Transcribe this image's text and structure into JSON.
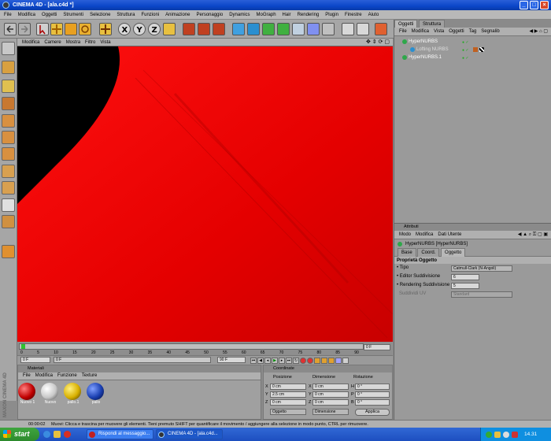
{
  "window": {
    "title": "CINEMA 4D - [ala.c4d *]",
    "buttons": {
      "minimize": "_",
      "maximize": "□",
      "close": "×"
    }
  },
  "menubar": [
    "File",
    "Modifica",
    "Oggetti",
    "Strumenti",
    "Selezione",
    "Struttura",
    "Funzioni",
    "Animazione",
    "Personaggio",
    "Dynamics",
    "MoGraph",
    "Hair",
    "Rendering",
    "Plugin",
    "Finestre",
    "Aiuto"
  ],
  "viewport": {
    "menu": [
      "Modifica",
      "Camere",
      "Mostra",
      "Filtro",
      "Vista"
    ]
  },
  "timeline": {
    "ticks": [
      "0",
      "5",
      "10",
      "15",
      "20",
      "25",
      "30",
      "35",
      "40",
      "45",
      "50",
      "55",
      "60",
      "65",
      "70",
      "75",
      "80",
      "85",
      "90"
    ],
    "end_frame": "0 F",
    "start_field": "0 F",
    "current_field": "0 F",
    "end_field": "90 F"
  },
  "materials": {
    "title": "Materiali",
    "menu": [
      "File",
      "Modifica",
      "Funzione",
      "Texture"
    ],
    "items": [
      {
        "label": "Nuovo 1",
        "color": "#c00000"
      },
      {
        "label": "Nuovo",
        "color": "#c8c8c8"
      },
      {
        "label": "pallo.1",
        "color": "#d8b000"
      },
      {
        "label": "pallo",
        "color": "#1a3fb0"
      }
    ]
  },
  "coordinates": {
    "title": "Coordinate",
    "headers": [
      "Posizione",
      "Dimensione",
      "Rotazione"
    ],
    "rows": [
      {
        "axis": "X",
        "pos": "0 cm",
        "dim_axis": "X",
        "dim": "0 cm",
        "rot_axis": "H",
        "rot": "0 °"
      },
      {
        "axis": "Y",
        "pos": "2.5 cm",
        "dim_axis": "Y",
        "dim": "0 cm",
        "rot_axis": "P",
        "rot": "0 °"
      },
      {
        "axis": "Z",
        "pos": "0 cm",
        "dim_axis": "Z",
        "dim": "0 cm",
        "rot_axis": "B",
        "rot": "0 °"
      }
    ],
    "mode_select": "Oggetto",
    "dim_select": "Dimensione",
    "apply_label": "Applica"
  },
  "objects_panel": {
    "tabs": [
      "Oggetti",
      "Struttura"
    ],
    "menu": [
      "File",
      "Modifica",
      "Vista",
      "Oggetti",
      "Tag",
      "Segnalib"
    ],
    "items": [
      {
        "name": "HyperNURBS",
        "indent": 0
      },
      {
        "name": "Lofting NURBS",
        "indent": 1
      },
      {
        "name": "HyperNURBS.1",
        "indent": 0
      }
    ]
  },
  "attributes_panel": {
    "title": "Attributi",
    "menu": [
      "Modo",
      "Modifica",
      "Dati Utente"
    ],
    "object_name": "HyperNURBS [HyperNURBS]",
    "tabs": [
      "Base",
      "Coord.",
      "Oggetto"
    ],
    "section": "Proprietà Oggetto",
    "fields": [
      {
        "label": "Tipo",
        "value": "Catmull-Clark (N-Angoli)"
      },
      {
        "label": "Editor Suddivisione",
        "value": "6"
      },
      {
        "label": "Rendering Suddivisione",
        "value": "5"
      },
      {
        "label": "Suddividi UV",
        "value": "Standard"
      }
    ]
  },
  "status": {
    "time": "00:00:02",
    "message": "Muovi: Clicca e trascina per muovere gli elementi. Tieni premuto SHIFT per quantificare il movimento / aggiungere alla selezione in modo punto, CTRL per rimuovere."
  },
  "taskbar": {
    "start_label": "start",
    "items": [
      "Rispondi al messaggio...",
      "CINEMA 4D - [ala.c4d..."
    ],
    "clock": "14.31"
  },
  "vertical_brand": "MAXON CINEMA 4D"
}
